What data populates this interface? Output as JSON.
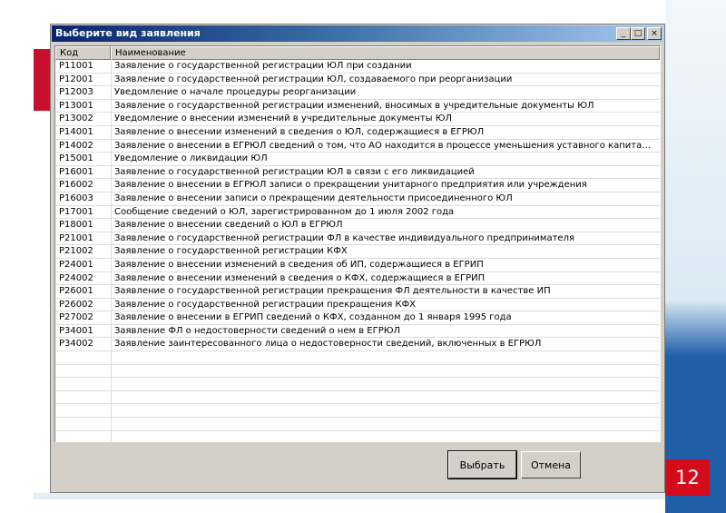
{
  "dialog": {
    "title": "Выберите вид заявления",
    "window_buttons": {
      "minimize": "_",
      "maximize": "□",
      "close": "×"
    }
  },
  "list": {
    "columns": {
      "code": "Код",
      "name": "Наименование"
    },
    "rows": [
      {
        "code": "P11001",
        "name": "Заявление о государственной регистрации ЮЛ при создании"
      },
      {
        "code": "P12001",
        "name": "Заявление о государственной регистрации ЮЛ, создаваемого при реорганизации"
      },
      {
        "code": "P12003",
        "name": "Уведомление о начале процедуры реорганизации"
      },
      {
        "code": "P13001",
        "name": "Заявление о государственной регистрации изменений, вносимых в учредительные документы ЮЛ"
      },
      {
        "code": "P13002",
        "name": "Уведомление о внесении изменений в учредительные документы ЮЛ"
      },
      {
        "code": "P14001",
        "name": "Заявление о внесении изменений в сведения о ЮЛ, содержащиеся в ЕГРЮЛ"
      },
      {
        "code": "P14002",
        "name": "Заявление о внесении в ЕГРЮЛ сведений о том, что АО находится в процессе уменьшения уставного капитала, а так..."
      },
      {
        "code": "P15001",
        "name": "Уведомление о ликвидации ЮЛ"
      },
      {
        "code": "P16001",
        "name": "Заявление о государственной регистрации ЮЛ в связи с его ликвидацией"
      },
      {
        "code": "P16002",
        "name": "Заявление о внесении в ЕГРЮЛ записи о прекращении унитарного предприятия или учреждения"
      },
      {
        "code": "P16003",
        "name": "Заявление о внесении записи о прекращении деятельности присоединенного ЮЛ"
      },
      {
        "code": "P17001",
        "name": "Сообщение сведений о ЮЛ, зарегистрированном до 1 июля 2002 года"
      },
      {
        "code": "P18001",
        "name": "Заявление о внесении сведений о ЮЛ в ЕГРЮЛ"
      },
      {
        "code": "P21001",
        "name": "Заявление о государственной регистрации ФЛ в качестве индивидуального предпринимателя"
      },
      {
        "code": "P21002",
        "name": "Заявление о государственной регистрации КФХ"
      },
      {
        "code": "P24001",
        "name": "Заявление о внесении изменений в сведения об ИП, содержащиеся в ЕГРИП"
      },
      {
        "code": "P24002",
        "name": "Заявление о внесении изменений в сведения о КФХ, содержащиеся в ЕГРИП"
      },
      {
        "code": "P26001",
        "name": "Заявление о государственной регистрации прекращения ФЛ деятельности в качестве ИП"
      },
      {
        "code": "P26002",
        "name": "Заявление о государственной регистрации прекращения КФХ"
      },
      {
        "code": "P27002",
        "name": "Заявление о внесении в ЕГРИП сведений о КФХ, созданном до 1 января 1995 года"
      },
      {
        "code": "P34001",
        "name": "Заявление ФЛ о недостоверности сведений о нем в ЕГРЮЛ"
      },
      {
        "code": "P34002",
        "name": "Заявление заинтересованного лица о недостоверности сведений, включенных в ЕГРЮЛ"
      },
      {
        "code": "",
        "name": ""
      },
      {
        "code": "",
        "name": ""
      },
      {
        "code": "",
        "name": ""
      },
      {
        "code": "",
        "name": ""
      },
      {
        "code": "",
        "name": ""
      },
      {
        "code": "",
        "name": ""
      },
      {
        "code": "",
        "name": ""
      }
    ]
  },
  "buttons": {
    "select": "Выбрать",
    "cancel": "Отмена"
  },
  "slide": {
    "page_number": "12"
  },
  "colors": {
    "accent_red": "#d40b1a",
    "accent_blue": "#1f5fa8",
    "title_blue": "#0a246a"
  }
}
